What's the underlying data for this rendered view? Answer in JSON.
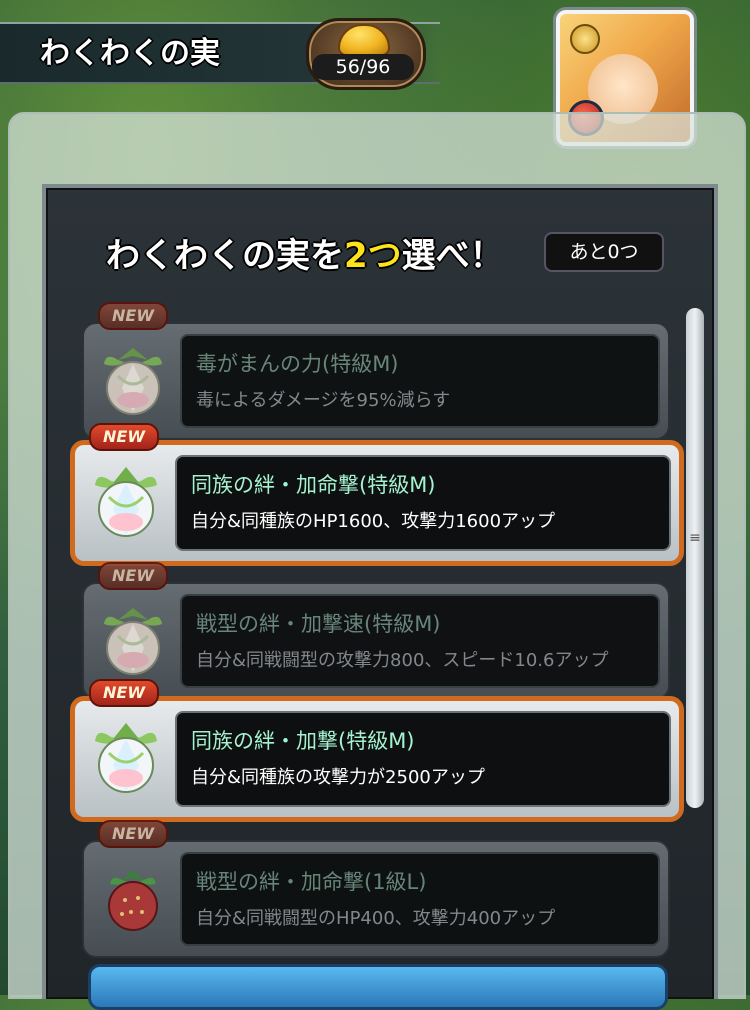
{
  "header": {
    "title": "わくわくの実",
    "counter": "56/96",
    "counter_icon": "golden-helmet-icon",
    "avatar_icon": "character-portrait-icon"
  },
  "panel": {
    "heading_pre": "わくわくの実を",
    "heading_highlight": "2つ",
    "heading_post": "選べ！",
    "remaining": "あと0つ"
  },
  "cards": [
    {
      "badge": "NEW",
      "name": "毒がまんの力(特級M)",
      "desc": "毒によるダメージを95%減らす",
      "state": "dim",
      "icon": "lotus-egg-fruit-icon"
    },
    {
      "badge": "NEW",
      "name": "同族の絆・加命撃(特級M)",
      "desc": "自分&同種族のHP1600、攻撃力1600アップ",
      "state": "selected",
      "icon": "lotus-egg-fruit-icon"
    },
    {
      "badge": "NEW",
      "name": "戦型の絆・加撃速(特級M)",
      "desc": "自分&同戦闘型の攻撃力800、スピード10.6アップ",
      "state": "dim",
      "icon": "lotus-egg-fruit-icon"
    },
    {
      "badge": "NEW",
      "name": "同族の絆・加撃(特級M)",
      "desc": "自分&同種族の攻撃力が2500アップ",
      "state": "selected",
      "icon": "lotus-egg-fruit-icon"
    },
    {
      "badge": "NEW",
      "name": "戦型の絆・加命撃(1級L)",
      "desc": "自分&同戦闘型のHP400、攻撃力400アップ",
      "state": "dim",
      "icon": "strawberry-fruit-icon"
    }
  ],
  "colors": {
    "accent_yellow": "#ffe21a",
    "selected_border": "#d06a1e",
    "new_badge": "#e04a2c"
  }
}
